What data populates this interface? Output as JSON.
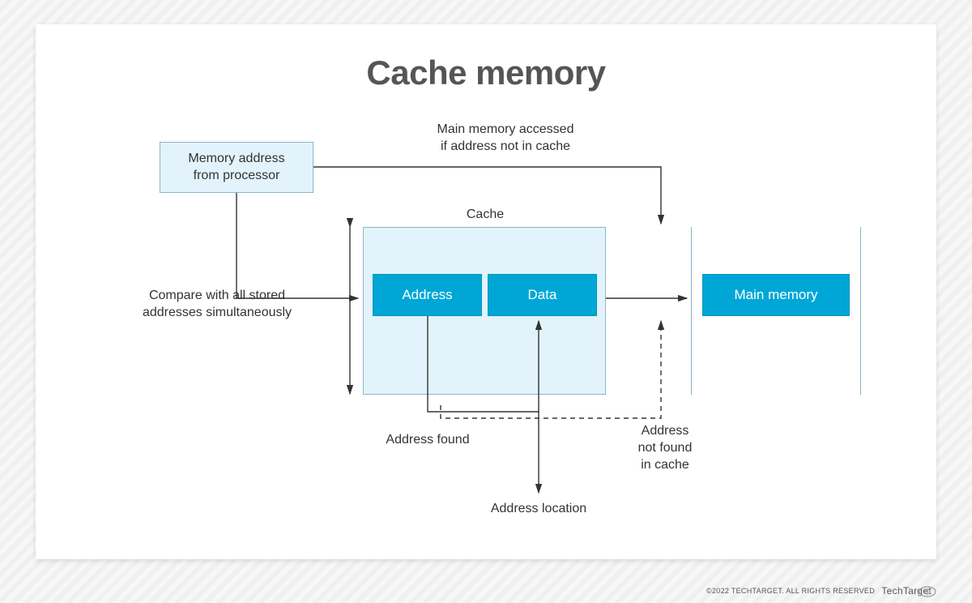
{
  "title": "Cache memory",
  "boxes": {
    "memory_address": "Memory address\nfrom processor",
    "address": "Address",
    "data": "Data",
    "main_memory": "Main memory"
  },
  "labels": {
    "main_memory_accessed": "Main memory accessed\nif address not in cache",
    "cache": "Cache",
    "compare": "Compare with all stored\naddresses simultaneously",
    "address_found": "Address found",
    "address_location": "Address location",
    "not_found": "Address\nnot found\nin cache"
  },
  "footer": {
    "copyright": "©2022 TECHTARGET. ALL RIGHTS RESERVED",
    "brand": "TechTarget"
  },
  "colors": {
    "light_fill": "#e2f3fb",
    "accent": "#00a7d6",
    "text": "#333333",
    "title": "#555555"
  }
}
